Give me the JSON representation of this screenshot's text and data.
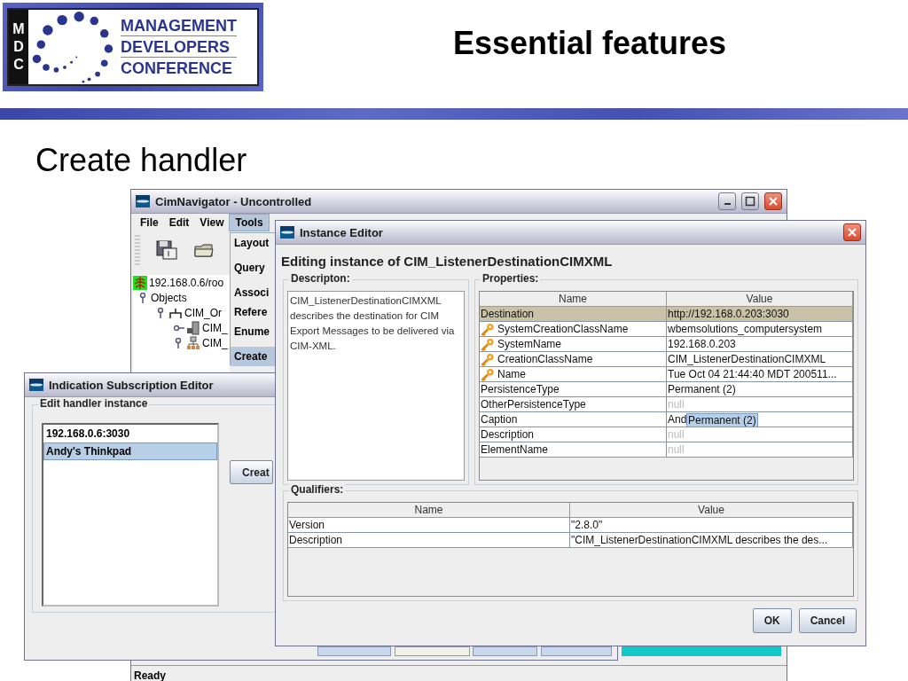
{
  "slide": {
    "logo": {
      "letters": [
        "M",
        "D",
        "C"
      ],
      "lines": [
        "MANAGEMENT",
        "DEVELOPERS",
        "CONFERENCE"
      ]
    },
    "title": "Essential features",
    "subtitle": "Create handler"
  },
  "main_window": {
    "title": "CimNavigator - Uncontrolled",
    "menu": [
      {
        "label": "File",
        "selected": false
      },
      {
        "label": "Edit",
        "selected": false
      },
      {
        "label": "View",
        "selected": false
      },
      {
        "label": "Tools",
        "selected": true
      }
    ],
    "tree": [
      {
        "label": "192.168.0.6/roo",
        "kind": "server",
        "children": [
          {
            "label": "Objects",
            "expanded": true,
            "children": [
              {
                "label": "CIM_Or",
                "kind": "branch",
                "expanded": true,
                "children": [
                  {
                    "label": "CIM_",
                    "kind": "computer",
                    "expanded": false
                  },
                  {
                    "label": "CIM_",
                    "kind": "network",
                    "expanded": true
                  }
                ]
              }
            ]
          }
        ]
      }
    ],
    "tools_menu": [
      {
        "kind": "item",
        "label": "Layout",
        "selected": false
      },
      {
        "kind": "separator"
      },
      {
        "kind": "item",
        "label": "Query",
        "selected": false
      },
      {
        "kind": "separator"
      },
      {
        "kind": "item",
        "label": "Associ",
        "selected": false
      },
      {
        "kind": "item",
        "label": "Refere",
        "selected": false
      },
      {
        "kind": "item",
        "label": "Enume",
        "selected": false
      },
      {
        "kind": "separator"
      },
      {
        "kind": "item",
        "label": "Create",
        "selected": true
      }
    ],
    "status": "Ready"
  },
  "subscription_editor": {
    "title": "Indication Subscription Editor",
    "group": "Edit handler instance",
    "handlers": [
      {
        "label": "192.168.0.6:3030",
        "selected": false
      },
      {
        "label": "Andy's Thinkpad",
        "selected": true
      }
    ],
    "button": "Creat"
  },
  "instance_editor": {
    "title": "Instance Editor",
    "heading": "Editing instance of CIM_ListenerDestinationCIMXML",
    "description_label": "Descripton:",
    "description": "CIM_ListenerDestinationCIMXML describes the destination for CIM Export Messages to be delivered via CIM-XML.",
    "properties_label": "Properties:",
    "properties_columns": [
      "Name",
      "Value"
    ],
    "properties": [
      {
        "name": "Destination",
        "value": "http://192.168.0.203:3030",
        "key": false,
        "selected": true,
        "empty": false
      },
      {
        "name": "SystemCreationClassName",
        "value": "wbemsolutions_computersystem",
        "key": true,
        "selected": false,
        "empty": false
      },
      {
        "name": "SystemName",
        "value": "192.168.0.203",
        "key": true,
        "selected": false,
        "empty": false
      },
      {
        "name": "CreationClassName",
        "value": "CIM_ListenerDestinationCIMXML",
        "key": true,
        "selected": false,
        "empty": false
      },
      {
        "name": "Name",
        "value": "Tue Oct 04 21:44:40 MDT 200511...",
        "key": true,
        "selected": false,
        "empty": false
      },
      {
        "name": "PersistenceType",
        "value": "Permanent (2)",
        "key": false,
        "selected": false,
        "empty": false
      },
      {
        "name": "OtherPersistenceType",
        "value": "null",
        "key": false,
        "selected": false,
        "empty": true
      },
      {
        "name": "Caption",
        "value": "And",
        "key": false,
        "selected": false,
        "empty": false,
        "popup": "Permanent (2)"
      },
      {
        "name": "Description",
        "value": "null",
        "key": false,
        "selected": false,
        "empty": true
      },
      {
        "name": "ElementName",
        "value": "null",
        "key": false,
        "selected": false,
        "empty": true
      }
    ],
    "qualifiers_label": "Qualifiers:",
    "qualifiers_columns": [
      "Name",
      "Value"
    ],
    "qualifiers": [
      {
        "name": "Version",
        "value": "\"2.8.0\""
      },
      {
        "name": "Description",
        "value": "\"CIM_ListenerDestinationCIMXML describes the des..."
      }
    ],
    "buttons": [
      "OK",
      "Cancel"
    ]
  }
}
